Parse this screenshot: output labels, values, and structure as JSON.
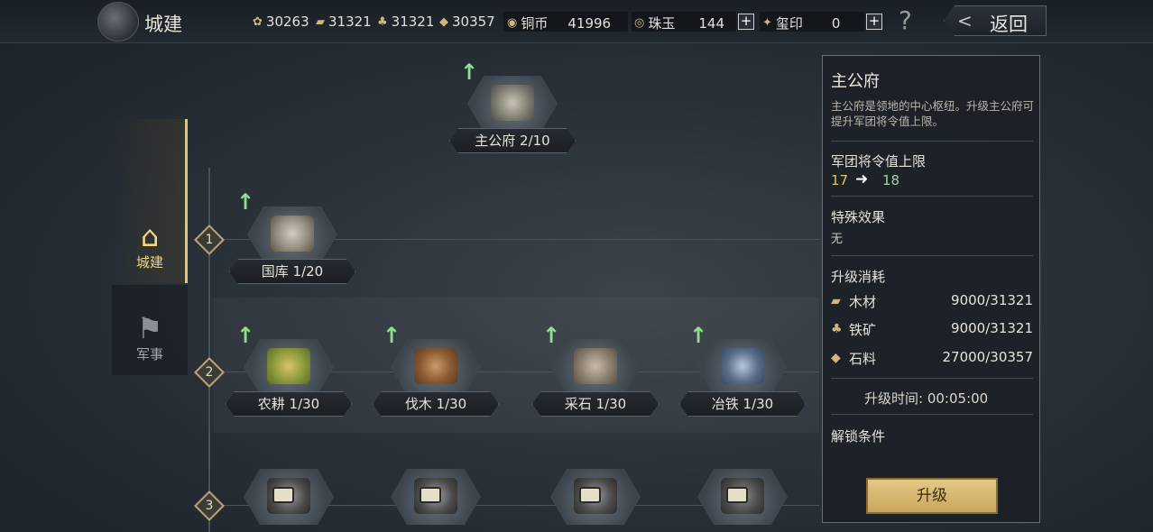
{
  "header": {
    "title": "城建",
    "back_label": "返回",
    "help_label": "?",
    "resources": [
      {
        "icon": "grain-icon",
        "glyph": "✿",
        "value": "30263"
      },
      {
        "icon": "wood-icon",
        "glyph": "▰",
        "value": "31321"
      },
      {
        "icon": "iron-icon",
        "glyph": "♣",
        "value": "31321"
      },
      {
        "icon": "stone-icon",
        "glyph": "◆",
        "value": "30357"
      }
    ],
    "copper": {
      "label": "铜币",
      "value": "41996"
    },
    "jade": {
      "label": "珠玉",
      "value": "144"
    },
    "seal": {
      "label": "玺印",
      "value": "0"
    }
  },
  "tabs": [
    {
      "label": "城建",
      "icon": "city-building-icon",
      "glyph": "🏯",
      "active": true
    },
    {
      "label": "军事",
      "icon": "military-flag-icon",
      "glyph": "⚑",
      "active": false
    }
  ],
  "main_building": {
    "name": "主公府 2/10"
  },
  "tiers": [
    "1",
    "2",
    "3"
  ],
  "tier1": [
    {
      "name": "国库 1/20"
    }
  ],
  "tier2": [
    {
      "name": "农耕 1/30"
    },
    {
      "name": "伐木 1/30"
    },
    {
      "name": "采石 1/30"
    },
    {
      "name": "冶铁 1/30"
    }
  ],
  "panel": {
    "title": "主公府",
    "description": "主公府是领地的中心枢纽。升级主公府可提升军团将令值上限。",
    "stat_label": "军团将令值上限",
    "stat_from": "17",
    "stat_arrow": "➜",
    "stat_to": "18",
    "effect_label": "特殊效果",
    "effect_value": "无",
    "cost_label": "升级消耗",
    "costs": [
      {
        "name": "木材",
        "icon": "wood-icon",
        "glyph": "▰",
        "amount": "9000/31321"
      },
      {
        "name": "铁矿",
        "icon": "iron-icon",
        "glyph": "♣",
        "amount": "9000/31321"
      },
      {
        "name": "石料",
        "icon": "stone-icon",
        "glyph": "◆",
        "amount": "27000/30357"
      }
    ],
    "time_label": "升级时间:",
    "time_value": "00:05:00",
    "unlock_label": "解锁条件",
    "upgrade_button": "升级"
  },
  "colors": {
    "accent_gold": "#e8c46a",
    "upgrade_green": "#8fe08a",
    "stat_to_green": "#9fd59a"
  }
}
